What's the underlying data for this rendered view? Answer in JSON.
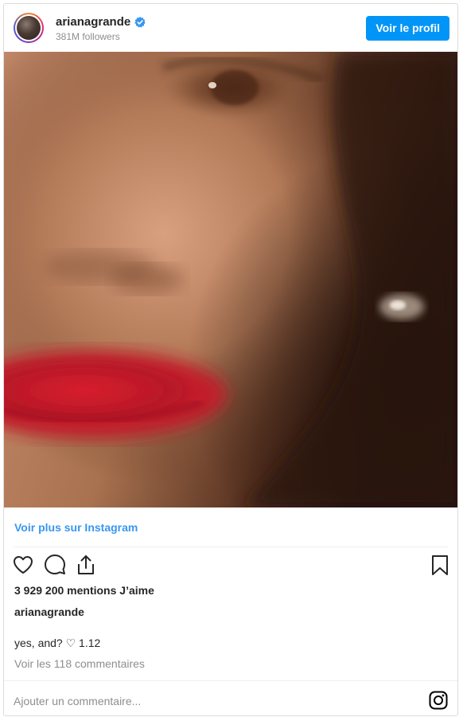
{
  "header": {
    "username": "arianagrande",
    "followers": "381M followers",
    "profile_button": "Voir le profil",
    "verified_icon": "verified-badge-icon"
  },
  "post": {
    "more_link": "Voir plus sur Instagram",
    "likes": "3 929 200 mentions J’aime",
    "caption_user": "arianagrande",
    "caption_text": "yes, and? ♡ 1.12",
    "comments_link": "Voir les 118 commentaires",
    "comment_placeholder": "Ajouter un commentaire..."
  },
  "icons": {
    "like": "heart-icon",
    "comment": "comment-icon",
    "share": "share-icon",
    "save": "bookmark-icon",
    "instagram": "instagram-logo-icon"
  },
  "colors": {
    "primary_button": "#0095f6",
    "link": "#3897f0",
    "muted_text": "#8e8e8e",
    "text": "#262626",
    "verified": "#3897f0"
  }
}
